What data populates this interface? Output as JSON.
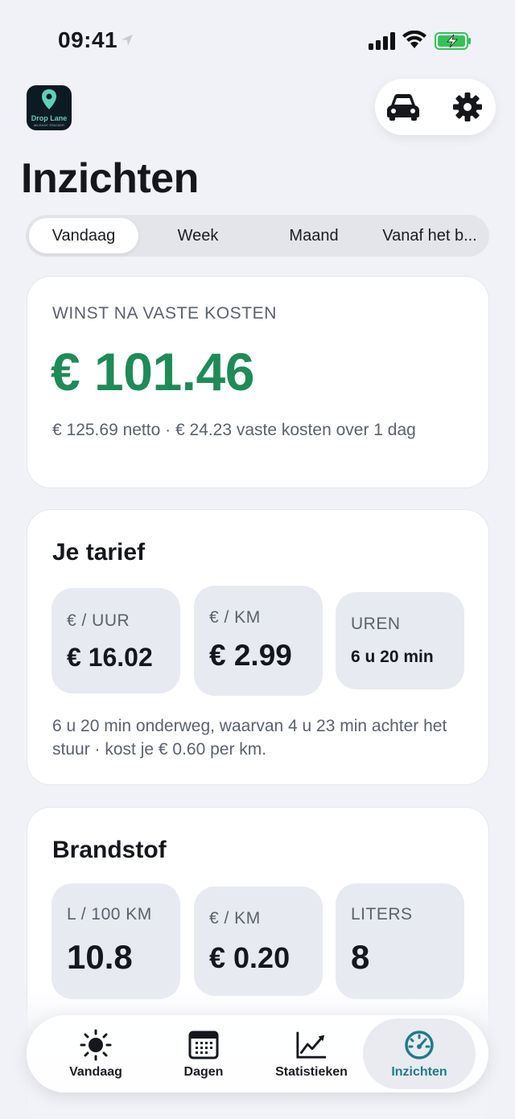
{
  "status": {
    "time": "09:41"
  },
  "app": {
    "logo_text": "Drop Lane",
    "logo_sub": "MILEAGE TRACKER"
  },
  "header": {
    "title": "Inzichten"
  },
  "tabs": [
    {
      "label": "Vandaag",
      "active": true
    },
    {
      "label": "Week",
      "active": false
    },
    {
      "label": "Maand",
      "active": false
    },
    {
      "label": "Vanaf het b...",
      "active": false
    }
  ],
  "profit": {
    "label": "WINST NA VASTE KOSTEN",
    "value": "€ 101.46",
    "description": "€ 125.69 netto · € 24.23 vaste kosten over 1 dag"
  },
  "rate": {
    "title": "Je tarief",
    "tiles": [
      {
        "label": "€ / UUR",
        "value": "€ 16.02"
      },
      {
        "label": "€ / KM",
        "value": "€ 2.99"
      },
      {
        "label": "UREN",
        "value": "6 u 20 min"
      }
    ],
    "description": "6 u 20 min onderweg, waarvan 4 u 23 min achter het stuur · kost je € 0.60 per km."
  },
  "fuel": {
    "title": "Brandstof",
    "tiles": [
      {
        "label": "L / 100 KM",
        "value": "10.8"
      },
      {
        "label": "€ / KM",
        "value": "€ 0.20"
      },
      {
        "label": "LITERS",
        "value": "8"
      }
    ]
  },
  "nav": {
    "items": [
      {
        "label": "Vandaag",
        "icon": "sun-icon",
        "active": false
      },
      {
        "label": "Dagen",
        "icon": "calendar-icon",
        "active": false
      },
      {
        "label": "Statistieken",
        "icon": "chart-icon",
        "active": false
      },
      {
        "label": "Inzichten",
        "icon": "speedometer-icon",
        "active": true
      }
    ]
  },
  "colors": {
    "accent_green": "#1f8b57",
    "accent_teal": "#1f7a8c",
    "background": "#f1f2f7"
  }
}
